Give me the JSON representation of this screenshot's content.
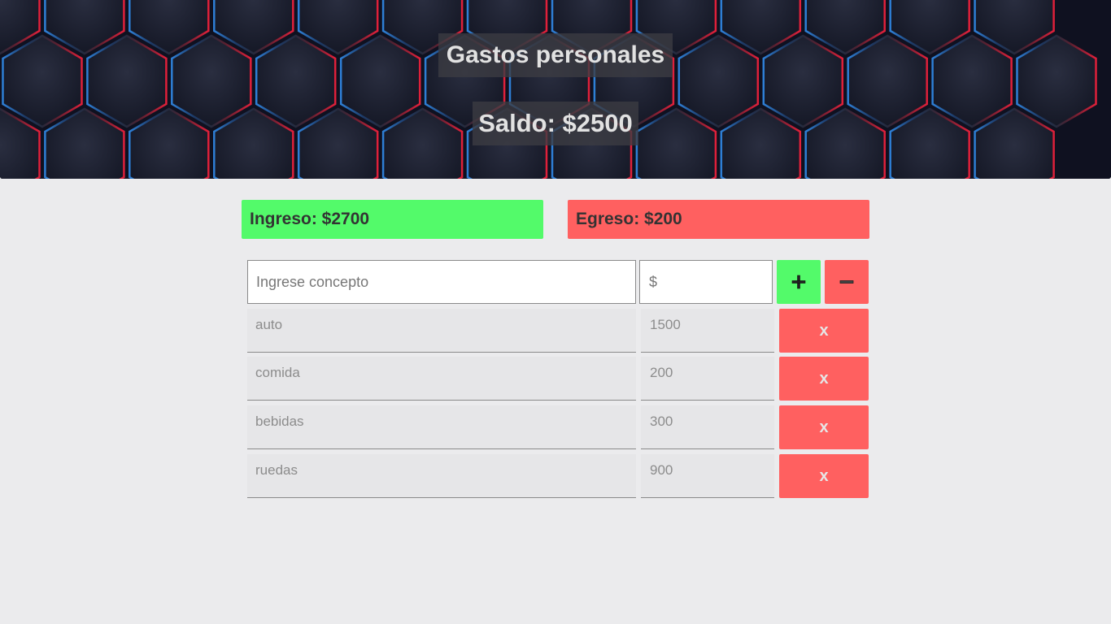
{
  "header": {
    "title": "Gastos personales",
    "balance": "Saldo: $2500"
  },
  "summary": {
    "income": "Ingreso: $2700",
    "expense": "Egreso: $200"
  },
  "form": {
    "concept_placeholder": "Ingrese concepto",
    "amount_placeholder": "$",
    "add_icon": "plus-icon",
    "subtract_icon": "minus-icon"
  },
  "items": [
    {
      "concept": "auto",
      "amount": "1500",
      "delete_label": "x"
    },
    {
      "concept": "comida",
      "amount": "200",
      "delete_label": "x"
    },
    {
      "concept": "bebidas",
      "amount": "300",
      "delete_label": "x"
    },
    {
      "concept": "ruedas",
      "amount": "900",
      "delete_label": "x"
    }
  ],
  "colors": {
    "income": "#53fa6a",
    "expense": "#ff6060",
    "background": "#ebebed"
  }
}
